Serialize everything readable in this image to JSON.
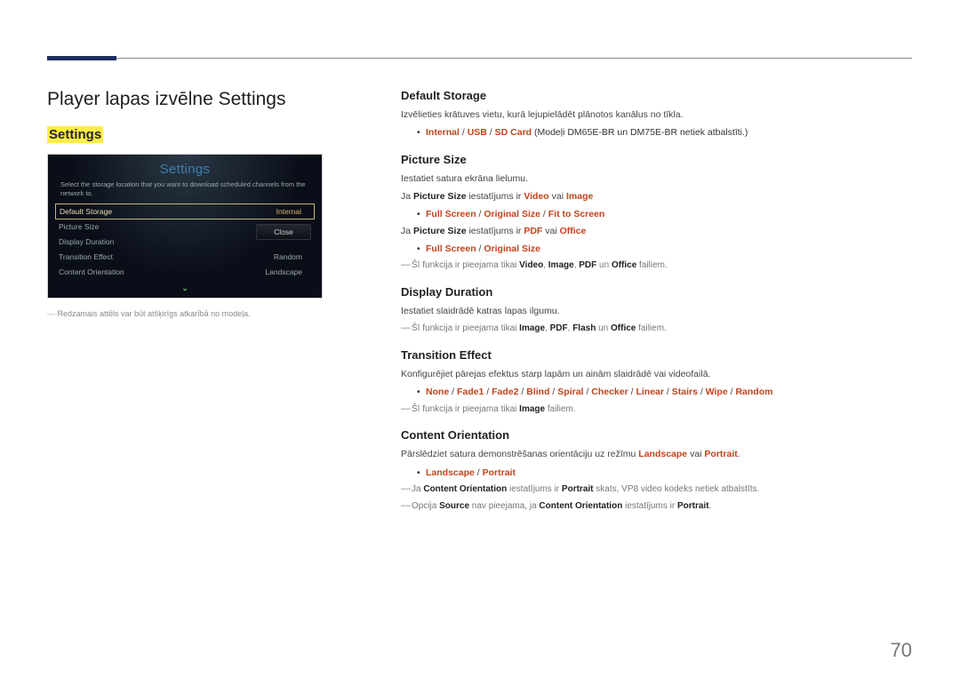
{
  "page_number": "70",
  "heading": "Player lapas izvēlne Settings",
  "side_title": "Settings",
  "ui": {
    "title": "Settings",
    "instruction": "Select the storage location that you want to download scheduled channels from the network to.",
    "rows": [
      {
        "label": "Default Storage",
        "value": "Internal"
      },
      {
        "label": "Picture Size",
        "value": ""
      },
      {
        "label": "Display Duration",
        "value": ""
      },
      {
        "label": "Transition Effect",
        "value": "Random"
      },
      {
        "label": "Content Orientation",
        "value": "Landscape"
      }
    ],
    "close": "Close"
  },
  "footnote_left": "Redzamais attēls var būt atšķirīgs atkarībā no modeļa.",
  "sections": {
    "default_storage": {
      "title": "Default Storage",
      "desc": "Izvēlieties krātuves vietu, kurā lejupielādēt plānotos kanālus no tīkla.",
      "opts": {
        "o1": "Internal",
        "o2": "USB",
        "o3": "SD Card"
      },
      "paren": " (Modeļi DM65E-BR un DM75E-BR netiek atbalstīti.)"
    },
    "picture_size": {
      "title": "Picture Size",
      "desc": "Iestatiet satura ekrāna lielumu.",
      "line1_pre": "Ja ",
      "line1_mid": " iestatījums ir ",
      "line1_or": " vai ",
      "labels": {
        "ps": "Picture Size",
        "video": "Video",
        "image": "Image",
        "pdf": "PDF",
        "office": "Office"
      },
      "opts1": {
        "o1": "Full Screen",
        "o2": "Original Size",
        "o3": "Fit to Screen"
      },
      "opts2": {
        "o1": "Full Screen",
        "o2": "Original Size"
      },
      "note_pre": "Šī funkcija ir pieejama tikai ",
      "note_sep": ", ",
      "note_and": " un ",
      "note_post": " failiem."
    },
    "display_duration": {
      "title": "Display Duration",
      "desc": "Iestatiet slaidrādē katras lapas ilgumu.",
      "note_pre": "Šī funkcija ir pieejama tikai ",
      "labels": {
        "image": "Image",
        "pdf": "PDF",
        "flash": "Flash",
        "office": "Office"
      },
      "note_sep": ", ",
      "note_and": " un ",
      "note_post": " failiem."
    },
    "transition_effect": {
      "title": "Transition Effect",
      "desc": "Konfigurējiet pārejas efektus starp lapām un ainām slaidrādē vai videofailā.",
      "opts": {
        "o1": "None",
        "o2": "Fade1",
        "o3": "Fade2",
        "o4": "Blind",
        "o5": "Spiral",
        "o6": "Checker",
        "o7": "Linear",
        "o8": "Stairs",
        "o9": "Wipe",
        "o10": "Random"
      },
      "note_pre": "Šī funkcija ir pieejama tikai ",
      "note_label": "Image",
      "note_post": " failiem."
    },
    "content_orientation": {
      "title": "Content Orientation",
      "desc_pre": "Pārslēdziet satura demonstrēšanas orientāciju uz režīmu ",
      "desc_or": " vai ",
      "desc_post": ".",
      "labels": {
        "landscape": "Landscape",
        "portrait": "Portrait",
        "co": "Content Orientation",
        "source": "Source"
      },
      "opts": {
        "o1": "Landscape",
        "o2": "Portrait"
      },
      "note1_pre": "Ja ",
      "note1_mid": " iestatījums ir ",
      "note1_post": " skats, VP8 video kodeks netiek atbalstīts.",
      "note2_pre": "Opcija ",
      "note2_mid": " nav pieejama, ja ",
      "note2_mid2": " iestatījums ir ",
      "note2_post": "."
    }
  }
}
